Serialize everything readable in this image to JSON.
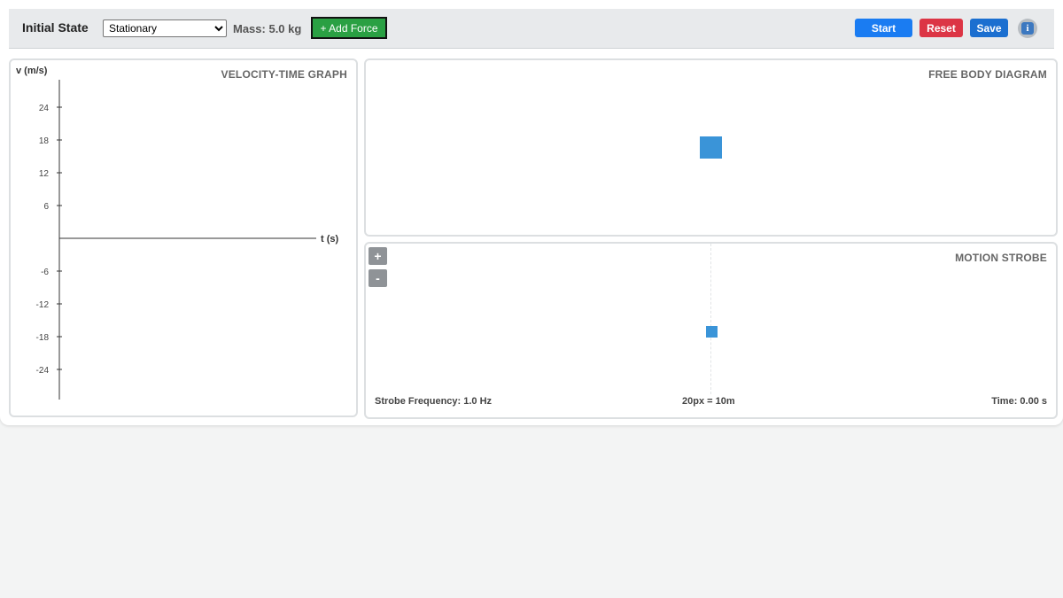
{
  "toolbar": {
    "title": "Initial State",
    "initial_state_selected": "Stationary",
    "mass_label": "Mass: 5.0 kg",
    "add_force_label": "+ Add Force",
    "start_label": "Start",
    "reset_label": "Reset",
    "save_label": "Save",
    "info_glyph": "i",
    "colors": {
      "add_force": "#2aa043",
      "start": "#1a7cf2",
      "reset": "#dc3545",
      "save": "#1b6fd0",
      "block": "#3a94d8"
    }
  },
  "vt_graph": {
    "title": "VELOCITY-TIME GRAPH",
    "ylabel": "v (m/s)",
    "xlabel": "t (s)",
    "yticks": [
      24,
      18,
      12,
      6,
      -6,
      -12,
      -18,
      -24
    ]
  },
  "fbd": {
    "title": "FREE BODY DIAGRAM"
  },
  "strobe": {
    "title": "MOTION STROBE",
    "zoom_in_label": "+",
    "zoom_out_label": "-",
    "frequency_text": "Strobe Frequency: 1.0 Hz",
    "scale_text": "20px = 10m",
    "time_text": "Time: 0.00 s"
  }
}
